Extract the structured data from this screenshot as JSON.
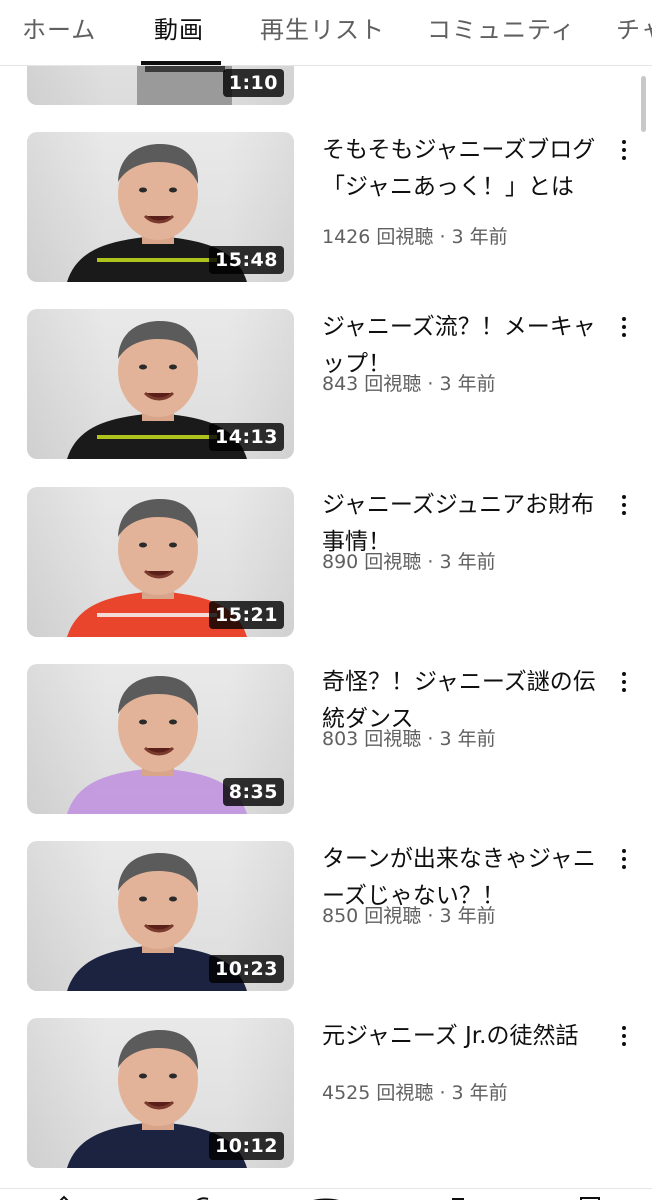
{
  "tabs": [
    {
      "label": "ホーム",
      "active": false
    },
    {
      "label": "動画",
      "active": true
    },
    {
      "label": "再生リスト",
      "active": false
    },
    {
      "label": "コミュニティ",
      "active": false
    },
    {
      "label": "チャ",
      "active": false
    }
  ],
  "partial_video": {
    "duration": "1:10"
  },
  "videos": [
    {
      "title": "そもそもジャニーズブログ「ジャニあっく！」とは",
      "views": "1426 回視聴",
      "age": "3 年前",
      "duration": "15:48",
      "shirt": "#1a1a1a",
      "shirt_accent": "#c9e21c"
    },
    {
      "title": "ジャニーズ流？！メーキャップ！",
      "views": "843 回視聴",
      "age": "3 年前",
      "duration": "14:13",
      "shirt": "#1a1a1a",
      "shirt_accent": "#c9e21c"
    },
    {
      "title": "ジャニーズジュニアお財布事情！",
      "views": "890 回視聴",
      "age": "3 年前",
      "duration": "15:21",
      "shirt": "#e8452c",
      "shirt_accent": "#f4f4f4"
    },
    {
      "title": "奇怪？！ジャニーズ謎の伝統ダンス",
      "views": "803 回視聴",
      "age": "3 年前",
      "duration": "8:35",
      "shirt": "#c59be0",
      "shirt_accent": "#c59be0"
    },
    {
      "title": "ターンが出来なきゃジャニーズじゃない？！",
      "views": "850 回視聴",
      "age": "3 年前",
      "duration": "10:23",
      "shirt": "#1c2340",
      "shirt_accent": "#1c2340"
    },
    {
      "title": "元ジャニーズ Jr.の徒然話",
      "views": "4525 回視聴",
      "age": "3 年前",
      "duration": "10:12",
      "shirt": "#1c2340",
      "shirt_accent": "#1c2340"
    }
  ],
  "separator": " · "
}
